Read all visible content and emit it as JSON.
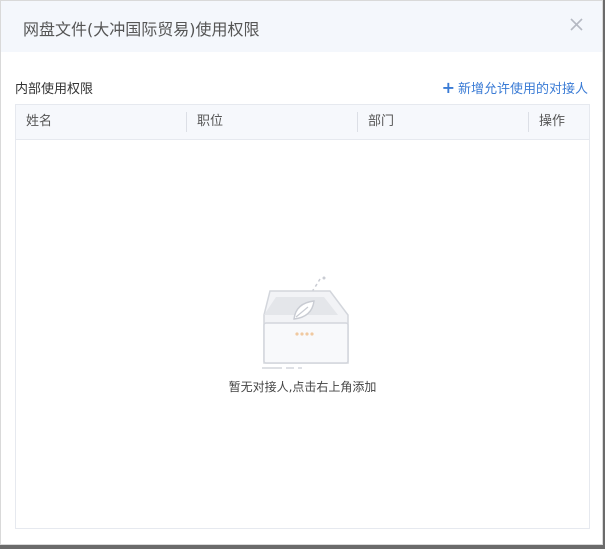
{
  "dialog": {
    "title": "网盘文件(大冲国际贸易)使用权限",
    "close_icon": "close-icon"
  },
  "section": {
    "label": "内部使用权限",
    "add_link": "新增允许使用的对接人",
    "add_icon": "plus-icon"
  },
  "table": {
    "columns": [
      "姓名",
      "职位",
      "部门",
      "操作"
    ],
    "rows": []
  },
  "empty": {
    "message": "暂无对接人,点击右上角添加",
    "icon": "empty-inbox-icon"
  },
  "colors": {
    "accent": "#3a7bd5",
    "header_bg": "#f4f7fc"
  }
}
